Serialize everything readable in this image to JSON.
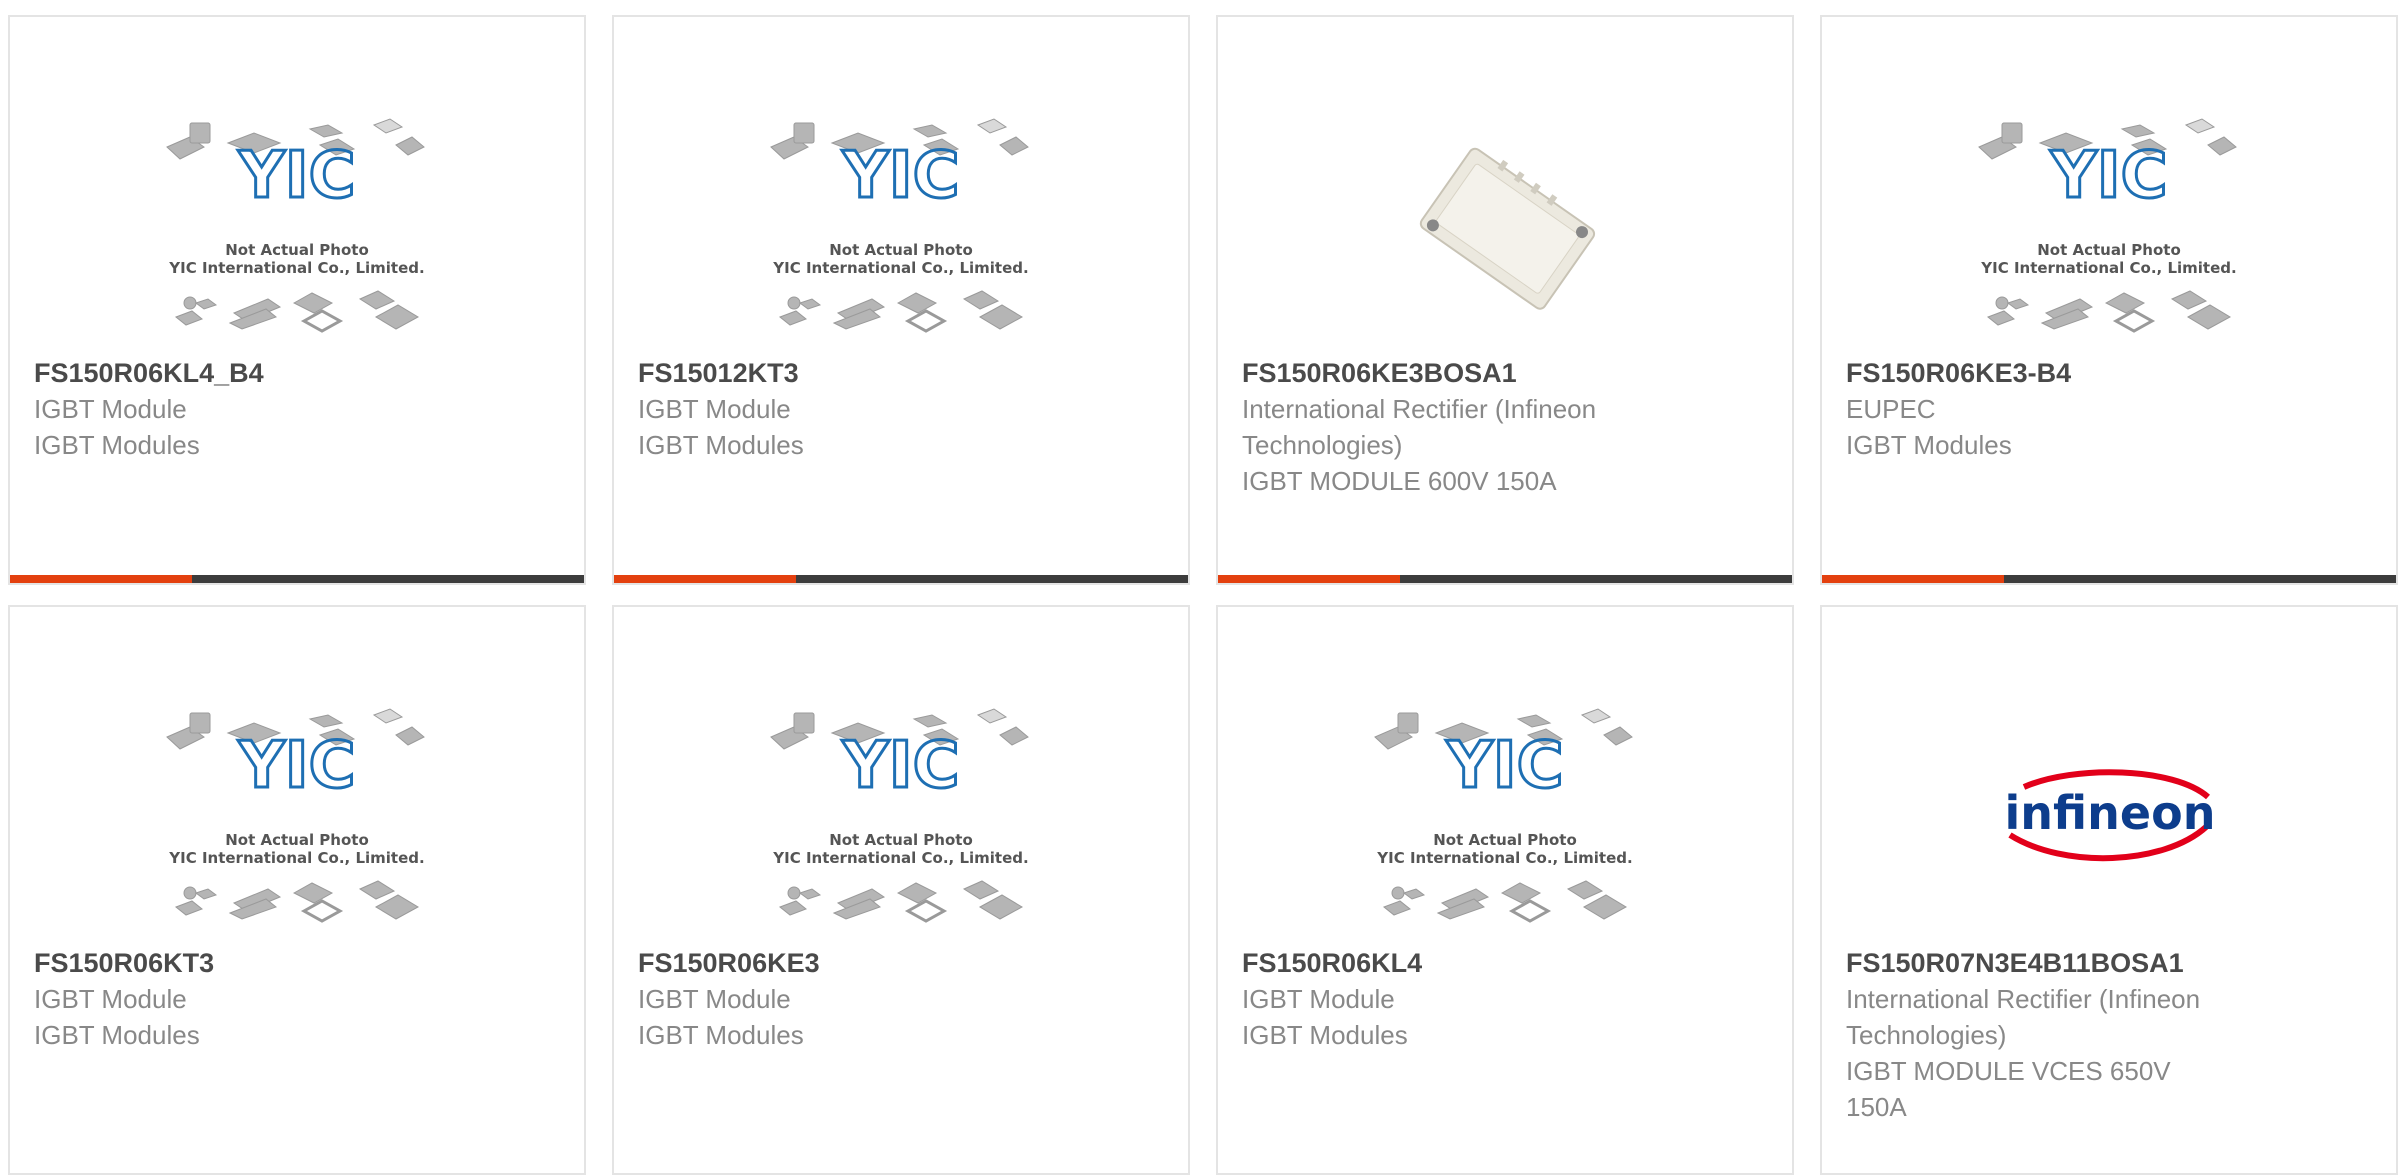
{
  "colors": {
    "accent": "#e3400f",
    "bar": "#3c3c3c",
    "part_number": "#4a4a4a",
    "text": "#888888",
    "border": "#e4e4e4",
    "yic_blue": "#1e6fb3",
    "infineon_red": "#e2001a",
    "infineon_blue": "#0d3d8c"
  },
  "placeholder": {
    "logo": "YIC",
    "line1": "Not Actual Photo",
    "line2": "YIC International Co., Limited."
  },
  "infineon_logo": "infineon",
  "products": [
    {
      "part_number": "FS150R06KL4_B4",
      "image": "placeholder",
      "lines": [
        "IGBT Module",
        "IGBT Modules"
      ]
    },
    {
      "part_number": "FS15012KT3",
      "image": "placeholder",
      "lines": [
        "IGBT Module",
        "IGBT Modules"
      ]
    },
    {
      "part_number": "FS150R06KE3BOSA1",
      "image": "module-photo",
      "lines": [
        "International Rectifier (Infineon",
        "Technologies)",
        "IGBT MODULE 600V 150A"
      ]
    },
    {
      "part_number": "FS150R06KE3-B4",
      "image": "placeholder",
      "lines": [
        "EUPEC",
        "IGBT Modules"
      ]
    },
    {
      "part_number": "FS150R06KT3",
      "image": "placeholder",
      "lines": [
        "IGBT Module",
        "IGBT Modules"
      ]
    },
    {
      "part_number": "FS150R06KE3",
      "image": "placeholder",
      "lines": [
        "IGBT Module",
        "IGBT Modules"
      ]
    },
    {
      "part_number": "FS150R06KL4",
      "image": "placeholder",
      "lines": [
        "IGBT Module",
        "IGBT Modules"
      ]
    },
    {
      "part_number": "FS150R07N3E4B11BOSA1",
      "image": "infineon-logo",
      "lines": [
        "International Rectifier (Infineon",
        "Technologies)",
        "IGBT MODULE VCES 650V",
        "150A"
      ]
    }
  ]
}
